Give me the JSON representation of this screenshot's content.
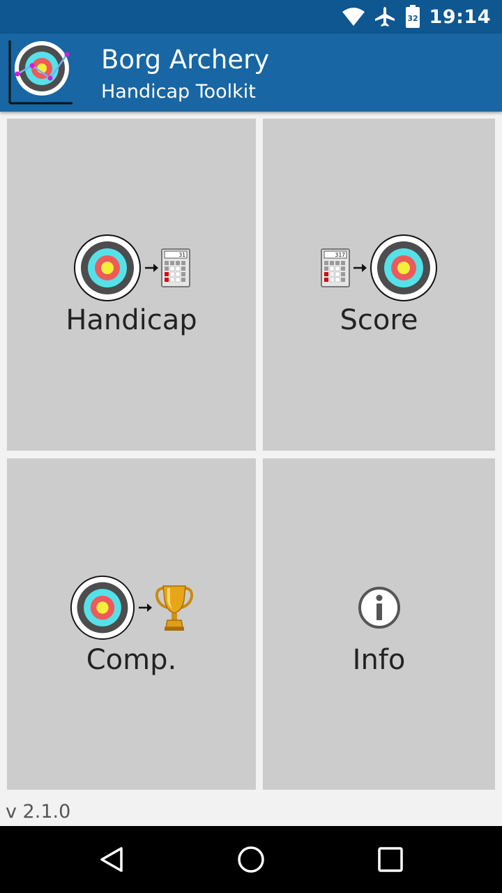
{
  "status_bar": {
    "time": "19:14",
    "battery_level": "32",
    "icons": [
      "wifi-icon",
      "airplane-mode-icon",
      "battery-icon"
    ]
  },
  "app_bar": {
    "title": "Borg Archery",
    "subtitle": "Handicap Toolkit"
  },
  "tiles": [
    {
      "label": "Handicap",
      "icon": "target-to-calculator-icon",
      "calc_display": "31"
    },
    {
      "label": "Score",
      "icon": "calculator-to-target-icon",
      "calc_display": "317"
    },
    {
      "label": "Comp.",
      "icon": "target-to-trophy-icon"
    },
    {
      "label": "Info",
      "icon": "info-icon"
    }
  ],
  "version": "v 2.1.0",
  "nav_bar": {
    "buttons": [
      "back-icon",
      "home-icon",
      "recents-icon"
    ]
  },
  "colors": {
    "status_bar": "#0e5790",
    "app_bar": "#1866a3",
    "tile_bg": "#cccccc",
    "target_outer": "#4d4d4d",
    "target_blue": "#55e1ea",
    "target_red": "#ee5a5a",
    "target_gold": "#f3f03c"
  }
}
